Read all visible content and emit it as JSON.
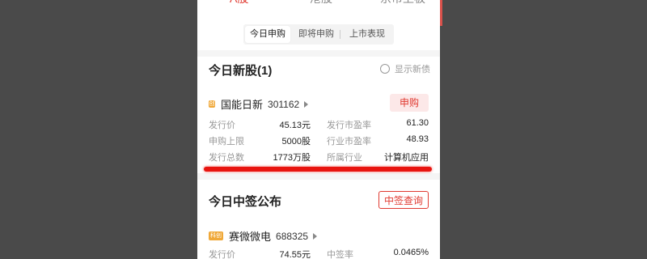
{
  "top_tabs": [
    {
      "label": "A股",
      "active": true
    },
    {
      "label": "港股",
      "active": false
    },
    {
      "label": "京市上板",
      "active": false
    }
  ],
  "segmented": [
    {
      "label": "今日申购",
      "active": true
    },
    {
      "label": "即将申购",
      "active": false
    },
    {
      "label": "上市表现",
      "active": false
    }
  ],
  "new_stocks": {
    "title": "今日新股(1)",
    "toggle_label": "显示新债",
    "stock": {
      "badge": "创",
      "name": "国能日新",
      "code": "301162",
      "apply_label": "申购",
      "rows": [
        {
          "l1": "发行价",
          "v1": "45.13元",
          "l2": "发行市盈率",
          "v2": "61.30"
        },
        {
          "l1": "申购上限",
          "v1": "5000股",
          "l2": "行业市盈率",
          "v2": "48.93"
        },
        {
          "l1": "发行总数",
          "v1": "1773万股",
          "l2": "所属行业",
          "v2": "计算机应用"
        }
      ]
    }
  },
  "winning": {
    "title": "今日中签公布",
    "query_label": "中签查询",
    "stock": {
      "badge": "科创",
      "name": "赛微微电",
      "code": "688325",
      "rows": [
        {
          "l1": "发行价",
          "v1": "74.55元",
          "l2": "中签率",
          "v2": "0.0465%"
        }
      ]
    }
  },
  "colors": {
    "accent": "#e03a31",
    "badge": "#f0a838",
    "highlight_line": "#e8140f"
  }
}
